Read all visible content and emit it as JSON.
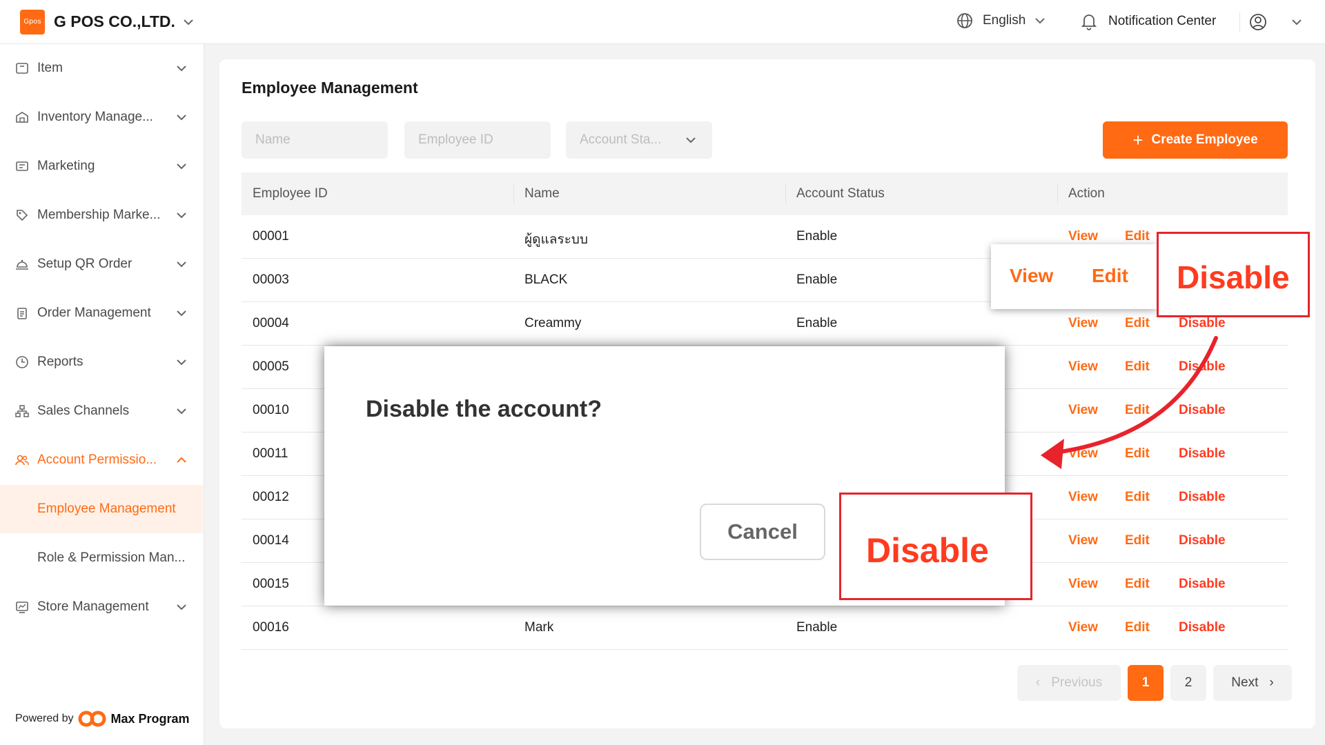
{
  "header": {
    "logo_text": "Gpos",
    "company": "G POS CO.,LTD.",
    "language": "English",
    "notification": "Notification Center"
  },
  "sidebar": {
    "items": [
      {
        "label": "Item",
        "icon": "box-icon"
      },
      {
        "label": "Inventory Manage...",
        "icon": "warehouse-icon"
      },
      {
        "label": "Marketing",
        "icon": "ticket-icon"
      },
      {
        "label": "Membership Marke...",
        "icon": "tag-icon"
      },
      {
        "label": "Setup QR Order",
        "icon": "bell-tray-icon"
      },
      {
        "label": "Order Management",
        "icon": "clipboard-icon"
      },
      {
        "label": "Reports",
        "icon": "clock-icon"
      },
      {
        "label": "Sales Channels",
        "icon": "network-icon"
      },
      {
        "label": "Account Permissio...",
        "icon": "users-icon"
      },
      {
        "label": "Store Management",
        "icon": "chart-monitor-icon"
      }
    ],
    "subitems": [
      {
        "label": "Employee Management"
      },
      {
        "label": "Role & Permission Man..."
      }
    ],
    "powered_by": "Powered by",
    "powered_name": "Max Program"
  },
  "main": {
    "title": "Employee Management",
    "filters": {
      "name_placeholder": "Name",
      "id_placeholder": "Employee ID",
      "status_placeholder": "Account Sta..."
    },
    "create_label": "Create Employee",
    "columns": [
      "Employee ID",
      "Name",
      "Account Status",
      "Action"
    ],
    "rows": [
      {
        "id": "00001",
        "name": "ผู้ดูแลระบบ",
        "status": "Enable"
      },
      {
        "id": "00003",
        "name": "BLACK",
        "status": "Enable"
      },
      {
        "id": "00004",
        "name": "Creammy",
        "status": "Enable"
      },
      {
        "id": "00005",
        "name": "",
        "status": ""
      },
      {
        "id": "00010",
        "name": "",
        "status": ""
      },
      {
        "id": "00011",
        "name": "",
        "status": ""
      },
      {
        "id": "00012",
        "name": "",
        "status": ""
      },
      {
        "id": "00014",
        "name": "",
        "status": ""
      },
      {
        "id": "00015",
        "name": "",
        "status": ""
      },
      {
        "id": "00016",
        "name": "Mark",
        "status": "Enable"
      }
    ],
    "actions": {
      "view": "View",
      "edit": "Edit",
      "disable": "Disable"
    },
    "pagination": {
      "previous": "Previous",
      "page1": "1",
      "page2": "2",
      "next": "Next"
    }
  },
  "callout": {
    "view": "View",
    "edit": "Edit",
    "disable": "Disable"
  },
  "modal": {
    "title": "Disable the account?",
    "cancel": "Cancel",
    "disable": "Disable"
  },
  "colors": {
    "accent": "#ff6a13",
    "danger": "#e8232b"
  }
}
